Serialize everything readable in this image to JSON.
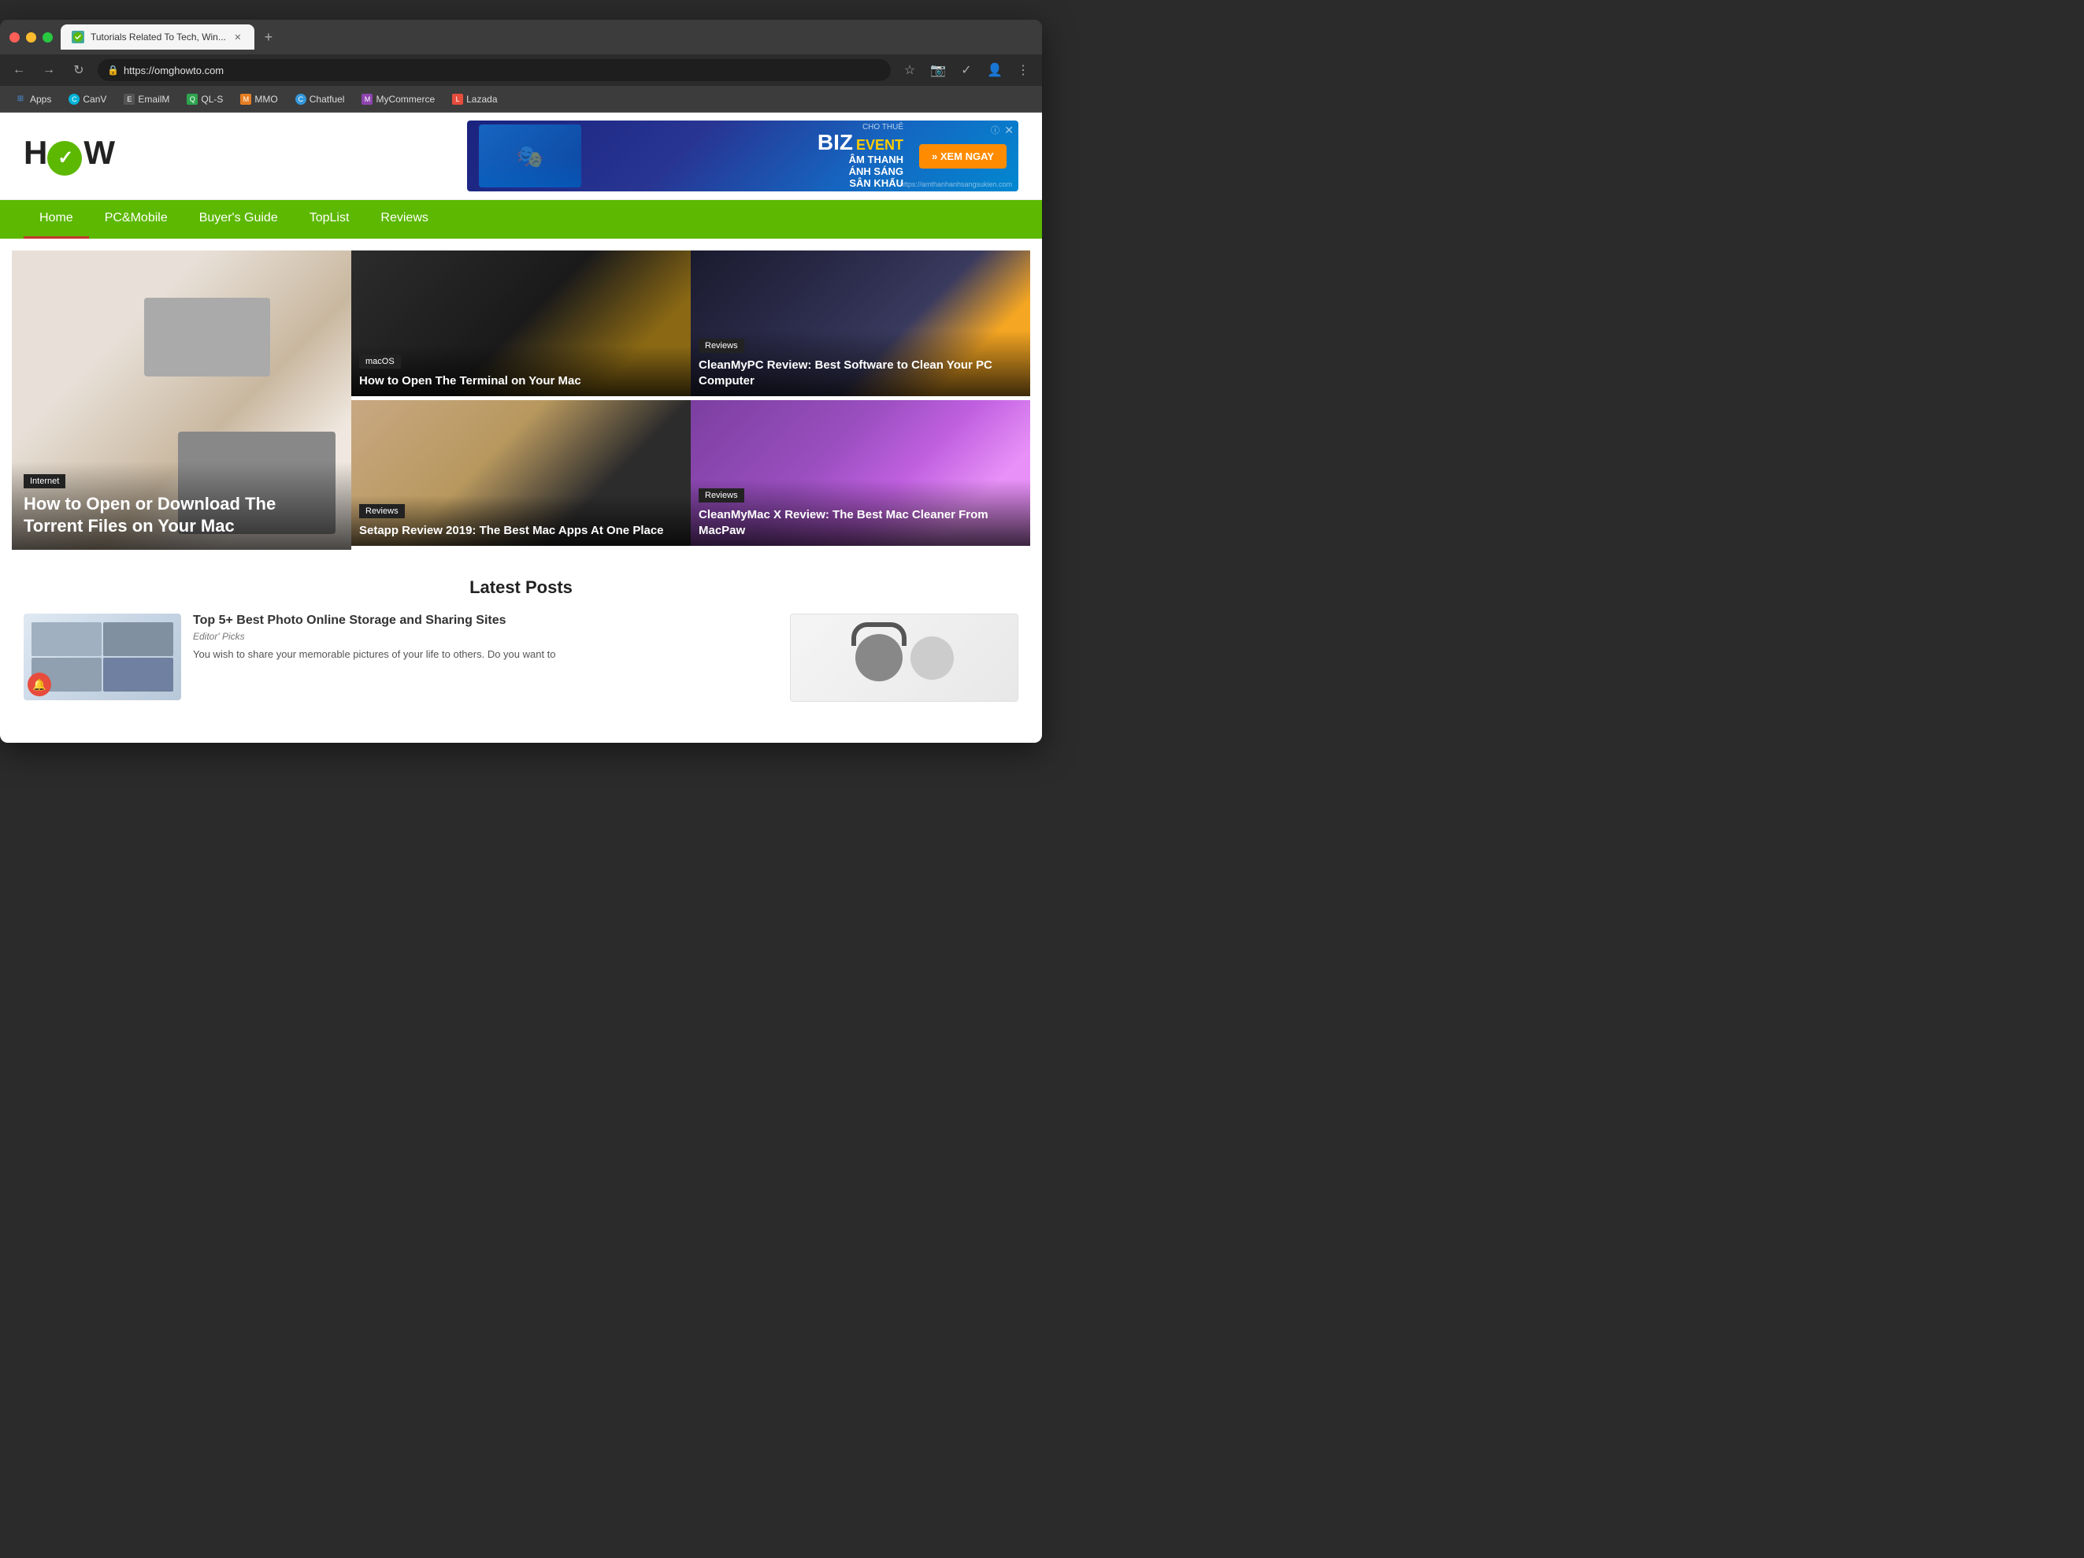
{
  "browser": {
    "tab_title": "Tutorials Related To Tech, Win...",
    "url": "https://omghowto.com",
    "new_tab_label": "+",
    "nav_back": "←",
    "nav_forward": "→",
    "nav_refresh": "↻"
  },
  "bookmarks": [
    {
      "id": "apps",
      "label": "Apps",
      "color": "#4a90d9",
      "icon": "⊞"
    },
    {
      "id": "canv",
      "label": "CanV",
      "color": "#00b4d8",
      "icon": "C"
    },
    {
      "id": "emailm",
      "label": "EmailM",
      "color": "#555",
      "icon": "E"
    },
    {
      "id": "ql-s",
      "label": "QL-S",
      "color": "#2ea44f",
      "icon": "Q"
    },
    {
      "id": "mmo",
      "label": "MMO",
      "color": "#e67e22",
      "icon": "M"
    },
    {
      "id": "chatfuel",
      "label": "Chatfuel",
      "color": "#3498db",
      "icon": "C"
    },
    {
      "id": "mycommerce",
      "label": "MyCommerce",
      "color": "#8e44ad",
      "icon": "M"
    },
    {
      "id": "lazada",
      "label": "Lazada",
      "color": "#e74c3c",
      "icon": "L"
    }
  ],
  "ad": {
    "brand": "BIZ",
    "brand_highlight": "EVENT",
    "line1": "CHO THUÊ",
    "line2": "ÂM THANH",
    "line3": "ÁNH SÁNG",
    "line4": "SÂN KHẤU",
    "cta": "» XEM NGAY",
    "url_text": "https://amthanhanhsangsukien.com"
  },
  "nav": {
    "items": [
      {
        "id": "home",
        "label": "Home",
        "active": true
      },
      {
        "id": "pcmobile",
        "label": "PC&Mobile",
        "active": false
      },
      {
        "id": "buyers-guide",
        "label": "Buyer's Guide",
        "active": false
      },
      {
        "id": "toplist",
        "label": "TopList",
        "active": false
      },
      {
        "id": "reviews",
        "label": "Reviews",
        "active": false
      }
    ]
  },
  "featured": {
    "main_article": {
      "category": "Internet",
      "title": "How to Open or Download The Torrent Files on Your Mac"
    },
    "secondary_top": {
      "category": "macOS",
      "title": "How to Open The Terminal on Your Mac"
    },
    "tertiary_top": {
      "category": "Reviews",
      "title": "CleanMyPC Review: Best Software to Clean Your PC Computer"
    },
    "secondary_bottom": {
      "category": "Reviews",
      "title": "Setapp Review 2019: The Best Mac Apps At One Place"
    },
    "tertiary_bottom": {
      "category": "Reviews",
      "title": "CleanMyMac X Review: The Best Mac Cleaner From MacPaw"
    }
  },
  "latest_posts": {
    "section_title": "Latest Posts",
    "posts": [
      {
        "title": "Top 5+ Best Photo Online Storage and Sharing Sites",
        "tag": "Editor' Picks",
        "excerpt": "You wish to share your memorable pictures of your life to others. Do you want to"
      }
    ]
  }
}
